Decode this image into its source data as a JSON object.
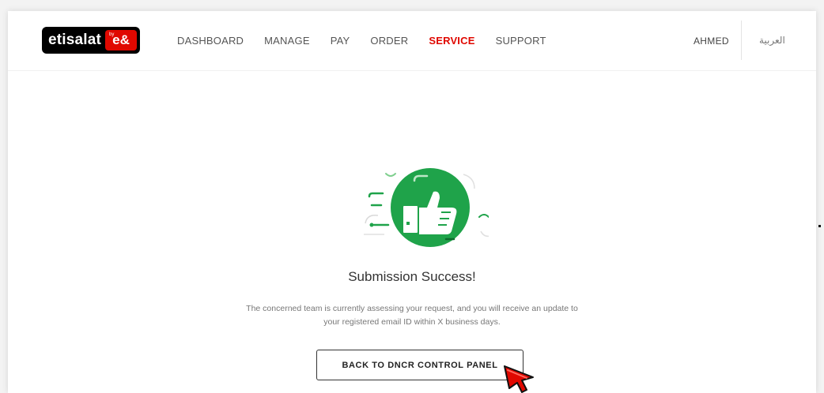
{
  "header": {
    "logo_text": "etisalat",
    "logo_badge_by": "by",
    "logo_badge": "e&",
    "nav": [
      {
        "label": "DASHBOARD",
        "active": false
      },
      {
        "label": "MANAGE",
        "active": false
      },
      {
        "label": "PAY",
        "active": false
      },
      {
        "label": "ORDER",
        "active": false
      },
      {
        "label": "SERVICE",
        "active": true
      },
      {
        "label": "SUPPORT",
        "active": false
      }
    ],
    "user_name": "AHMED",
    "language": "العربية"
  },
  "main": {
    "title": "Submission Success!",
    "message_line1": "The concerned team is currently assessing your request, and you will receive an update to",
    "message_line2": "your registered email ID within X business days.",
    "back_button_label": "BACK TO DNCR CONTROL PANEL"
  },
  "icons": {
    "illustration": "thumbs-up-success-icon",
    "cursor": "mouse-pointer-icon"
  },
  "colors": {
    "brand_red": "#e00800",
    "success_green": "#1fa34a",
    "logo_bg": "#000000"
  }
}
